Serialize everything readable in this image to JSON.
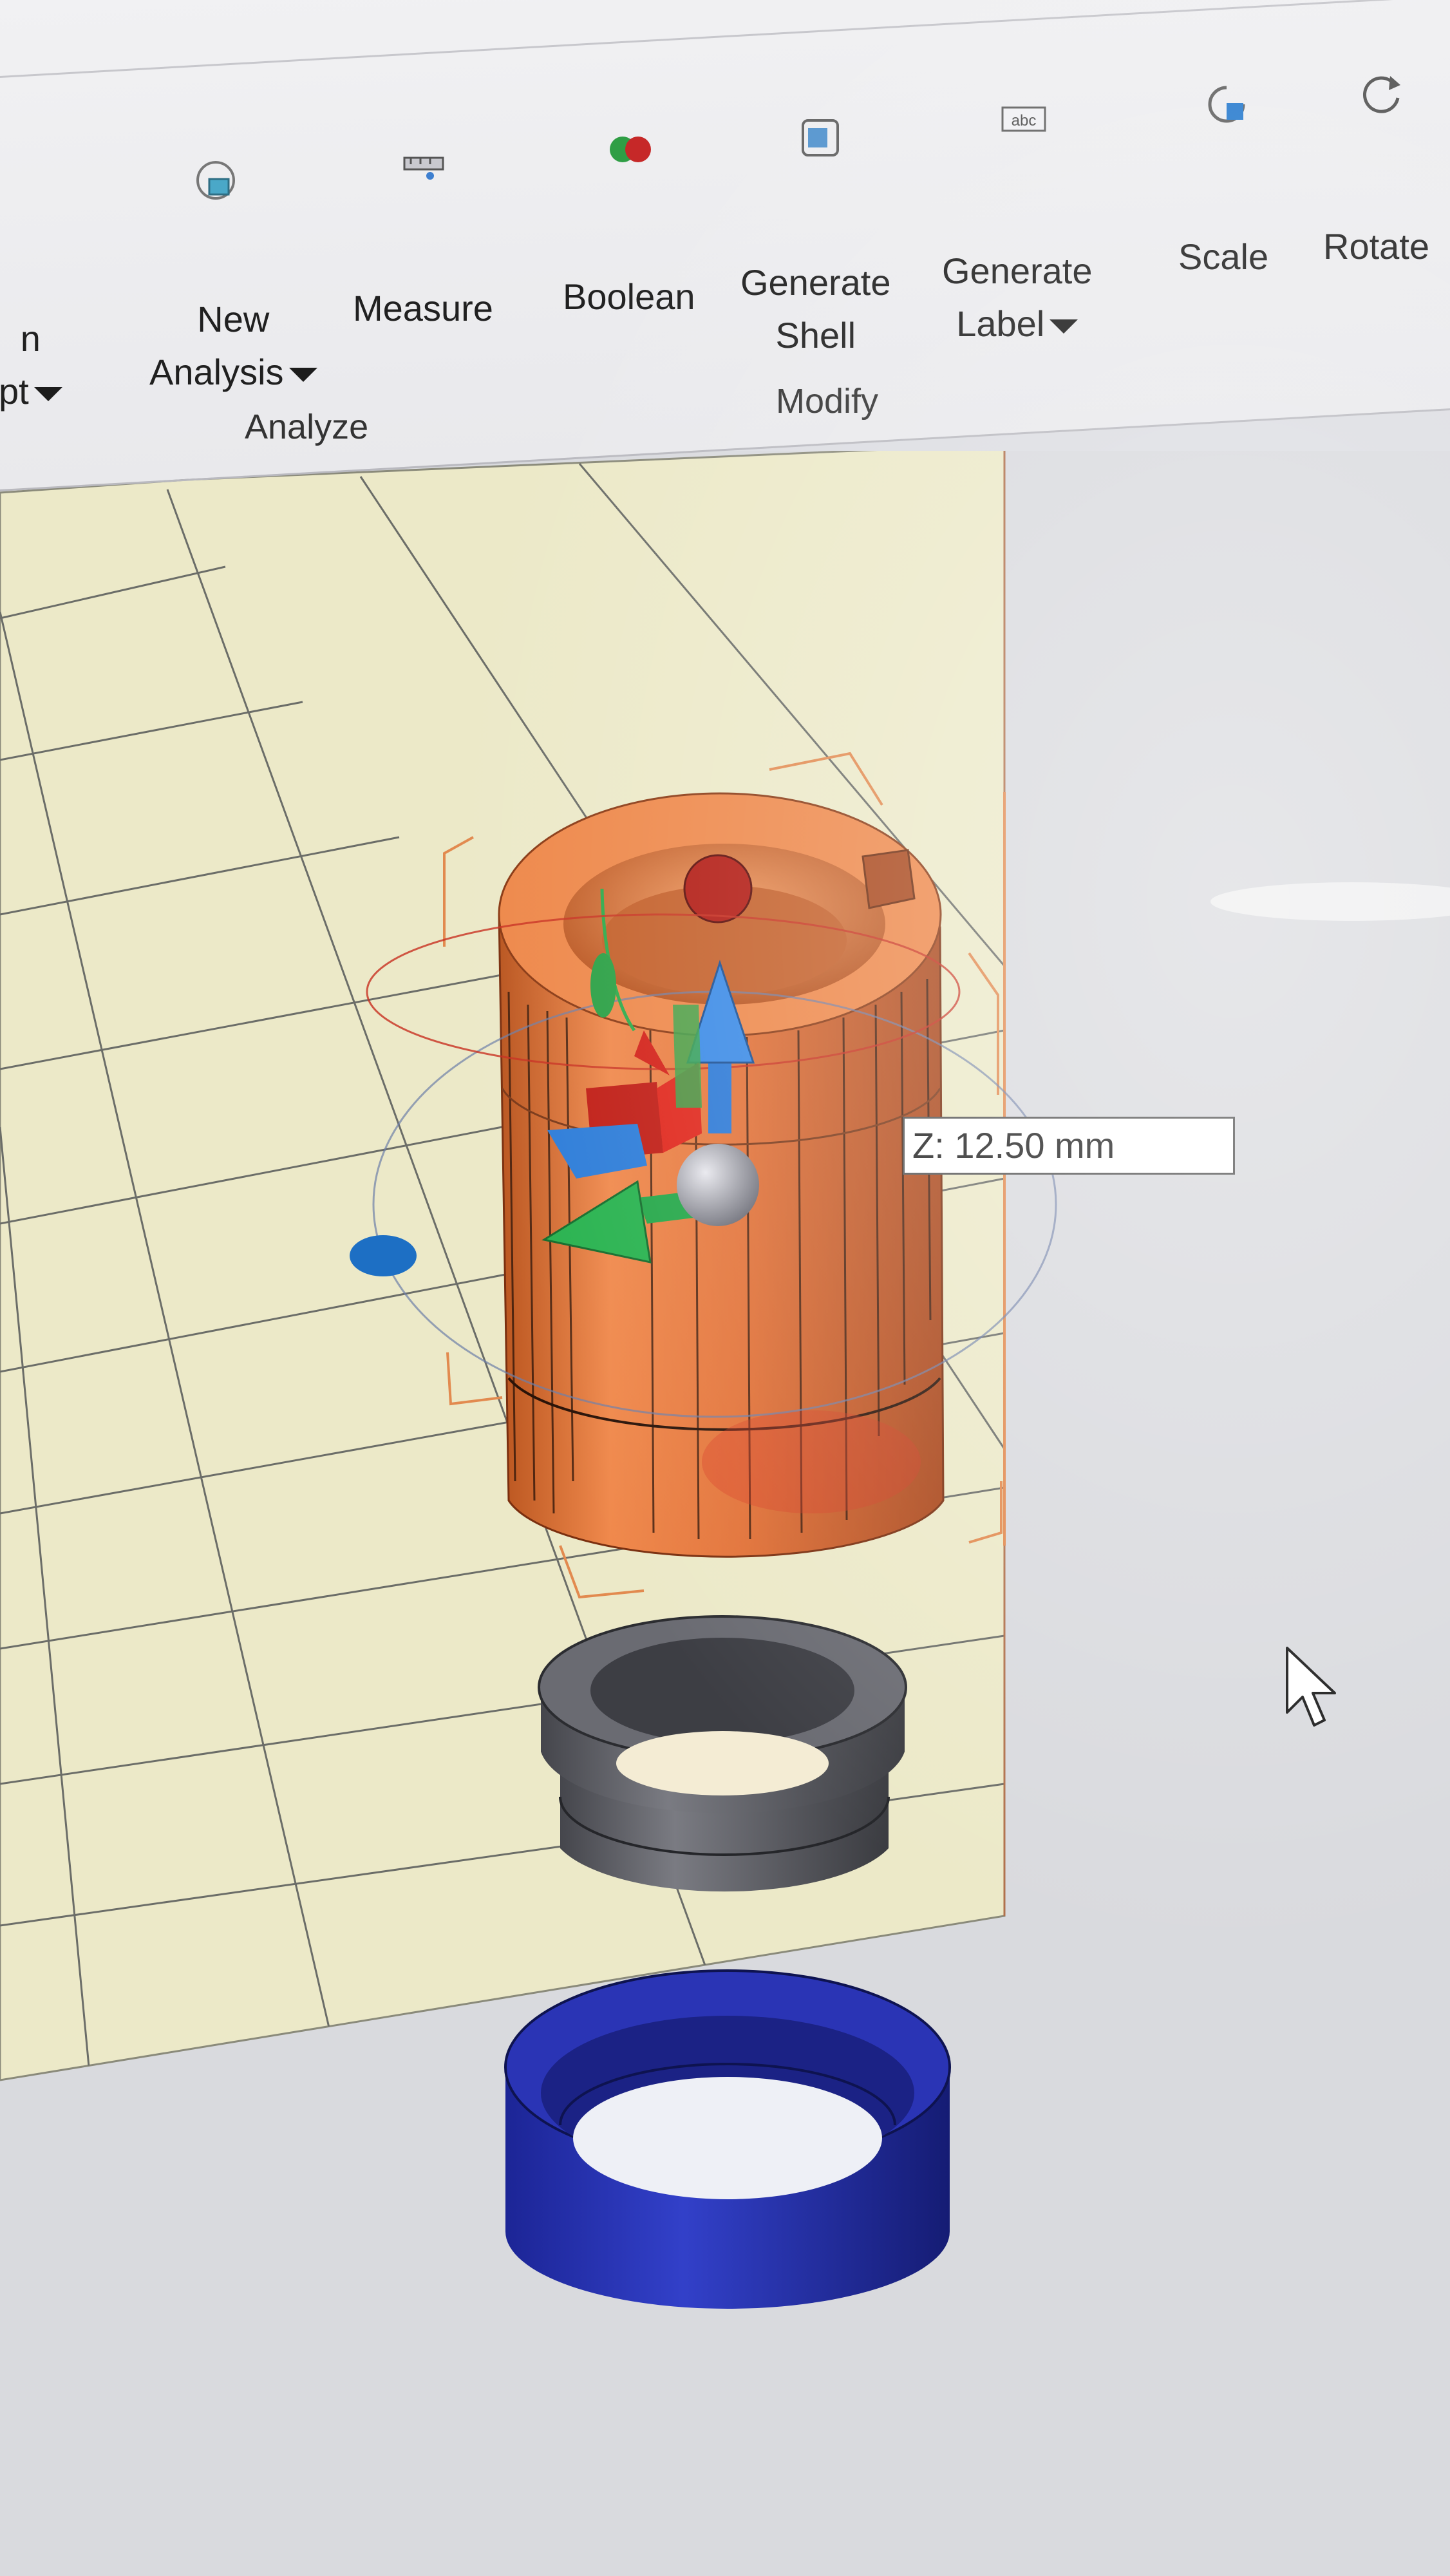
{
  "ribbon": {
    "tools": [
      {
        "id": "script",
        "label_lines": [
          "n",
          "pt"
        ],
        "dropdown": true
      },
      {
        "id": "new-analysis",
        "label_lines": [
          "New",
          "Analysis"
        ],
        "dropdown": true
      },
      {
        "id": "measure",
        "label_lines": [
          "Measure"
        ],
        "dropdown": false
      },
      {
        "id": "boolean",
        "label_lines": [
          "Boolean"
        ],
        "dropdown": false
      },
      {
        "id": "generate-shell",
        "label_lines": [
          "Generate",
          "Shell"
        ],
        "dropdown": false
      },
      {
        "id": "generate-label",
        "label_lines": [
          "Generate",
          "Label"
        ],
        "dropdown": true
      },
      {
        "id": "scale",
        "label_lines": [
          "Scale"
        ],
        "dropdown": false
      },
      {
        "id": "rotate",
        "label_lines": [
          "Rotate"
        ],
        "dropdown": false
      }
    ],
    "groups": {
      "analyze": "Analyze",
      "modify": "Modify"
    }
  },
  "viewport": {
    "coordinate_readout": "Z: 12.50 mm",
    "part_colors": {
      "selected_part": "#e9783b",
      "middle_ring": "#5d5f66",
      "bottom_ring": "#2b36b8",
      "build_plate": "#efecc8"
    }
  },
  "gizmo": {
    "icons": [
      "translate-x-arrow-icon",
      "translate-y-arrow-icon",
      "translate-z-arrow-icon",
      "rotate-ring-icon",
      "center-sphere-icon"
    ]
  }
}
